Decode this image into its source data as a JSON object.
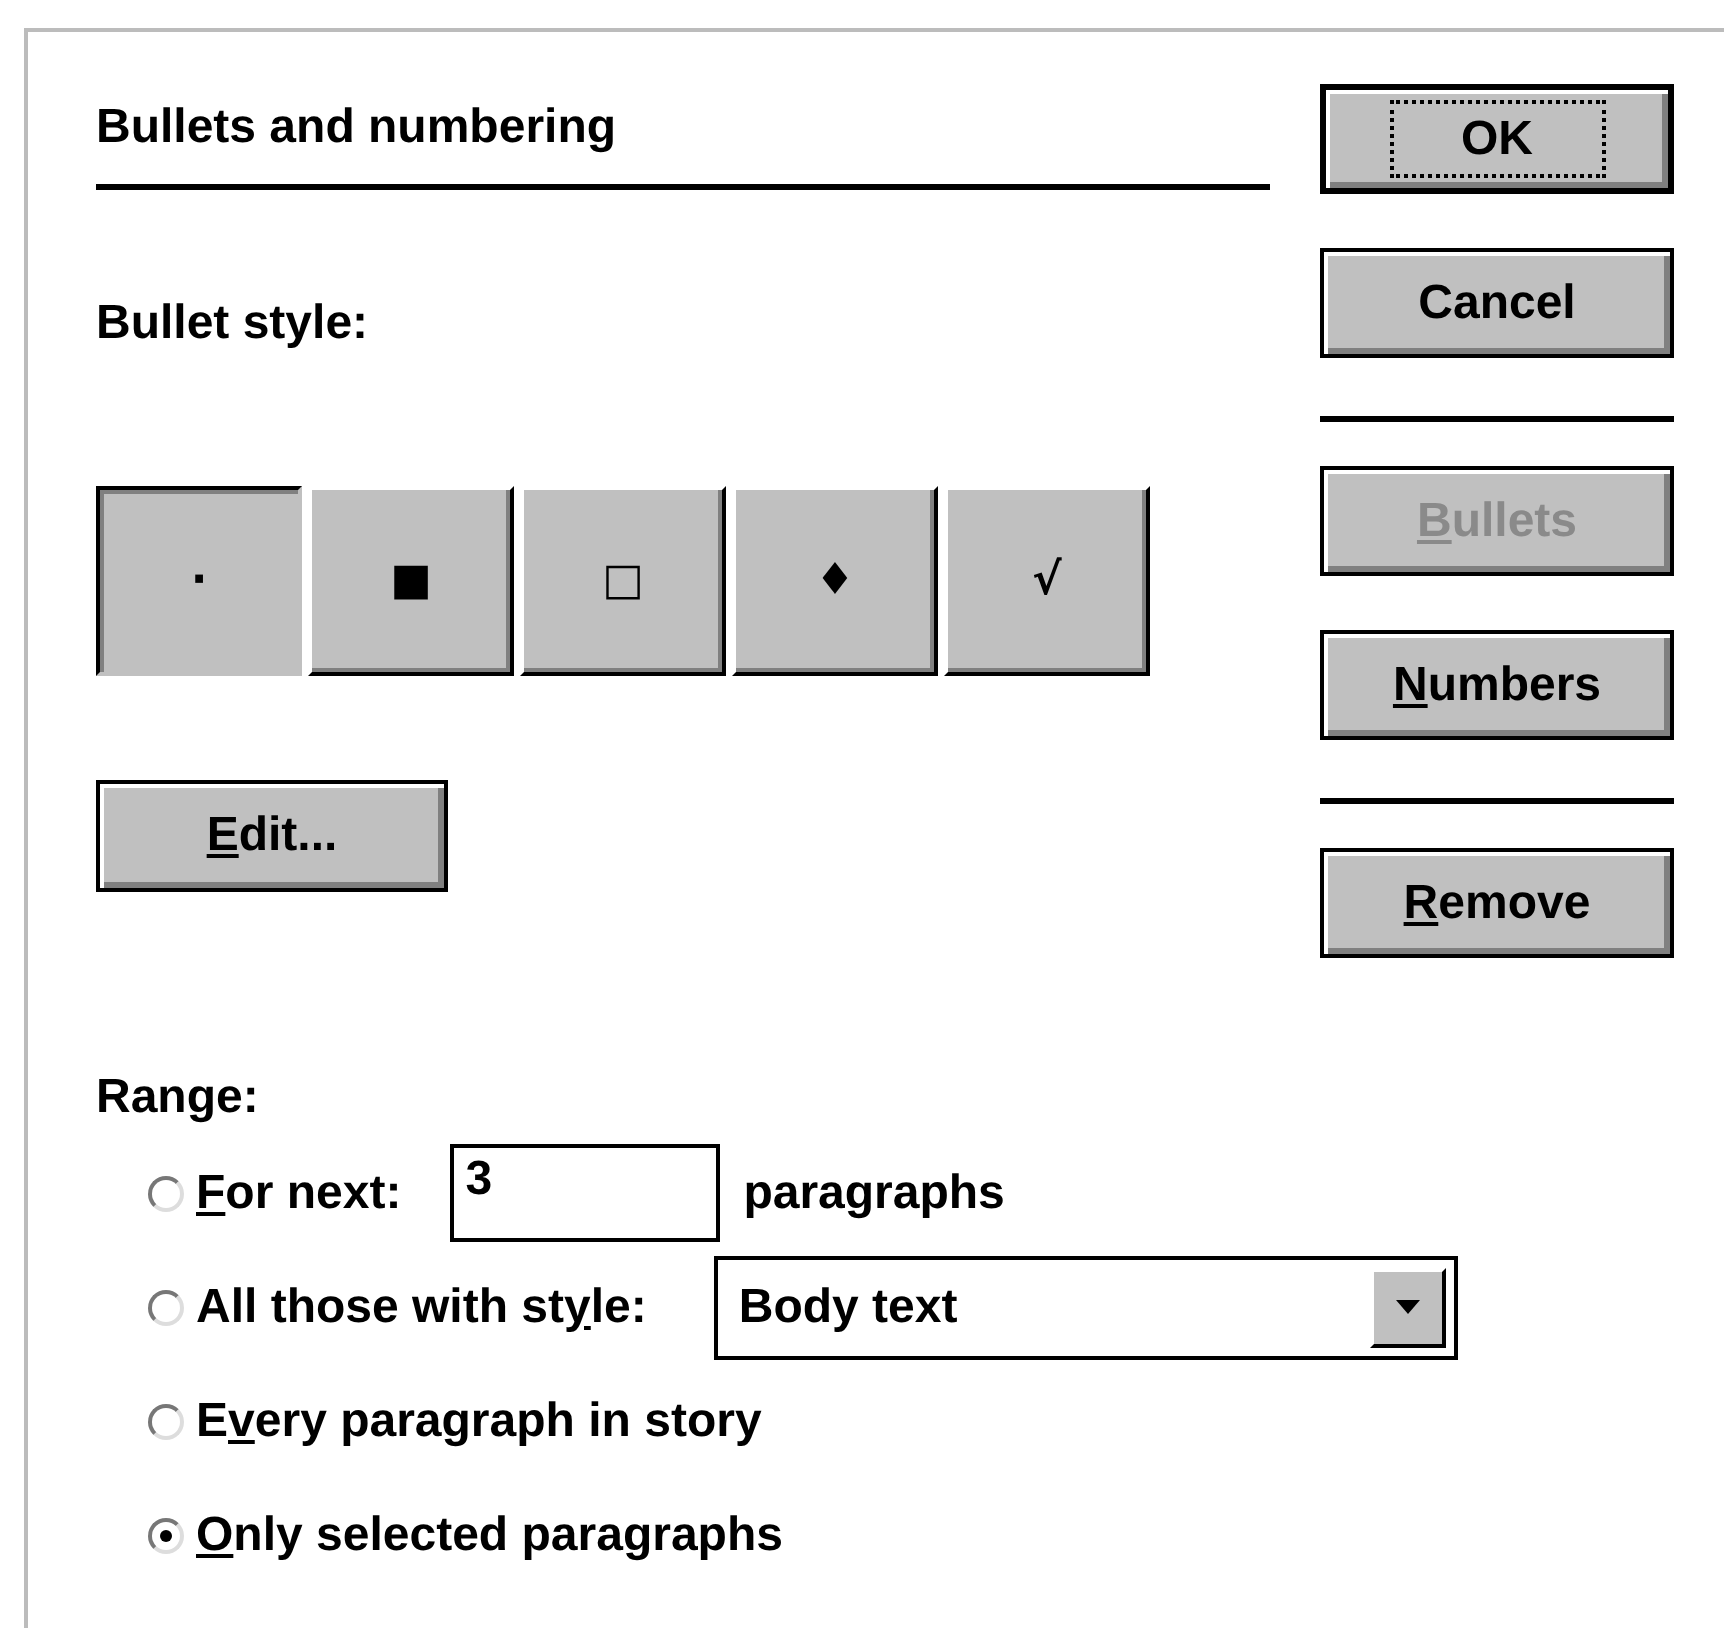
{
  "title": "Bullets and numbering",
  "bullet_style_label": "Bullet style:",
  "bullet_styles": [
    {
      "glyph": "·",
      "selected": true
    },
    {
      "glyph": "■",
      "selected": false
    },
    {
      "glyph": "□",
      "selected": false
    },
    {
      "glyph": "♦",
      "selected": false
    },
    {
      "glyph": "√",
      "selected": false
    }
  ],
  "edit_button": {
    "key": "E",
    "after": "dit..."
  },
  "side_buttons": [
    {
      "kind": "button",
      "after": "OK",
      "default": true,
      "disabled": false
    },
    {
      "kind": "button",
      "after": "Cancel",
      "default": false,
      "disabled": false
    },
    {
      "kind": "rule"
    },
    {
      "kind": "button",
      "key": "B",
      "after": "ullets",
      "default": false,
      "disabled": true
    },
    {
      "kind": "button",
      "key": "N",
      "after": "umbers",
      "default": false,
      "disabled": false
    },
    {
      "kind": "rule"
    },
    {
      "kind": "button",
      "key": "R",
      "after": "emove",
      "default": false,
      "disabled": false
    }
  ],
  "range_label": "Range:",
  "range_options": [
    {
      "kind": "input",
      "key": "F",
      "after": "or next:",
      "selected": false,
      "value": "3",
      "suffix": "paragraphs"
    },
    {
      "kind": "dropdown",
      "before": "All those with st",
      "key": "y",
      "after": "le:",
      "selected": false,
      "value": "Body text"
    },
    {
      "kind": "plain",
      "before": "E",
      "key": "v",
      "after": "ery paragraph in story",
      "selected": false
    },
    {
      "kind": "plain",
      "key": "O",
      "after": "nly selected paragraphs",
      "selected": true
    }
  ]
}
